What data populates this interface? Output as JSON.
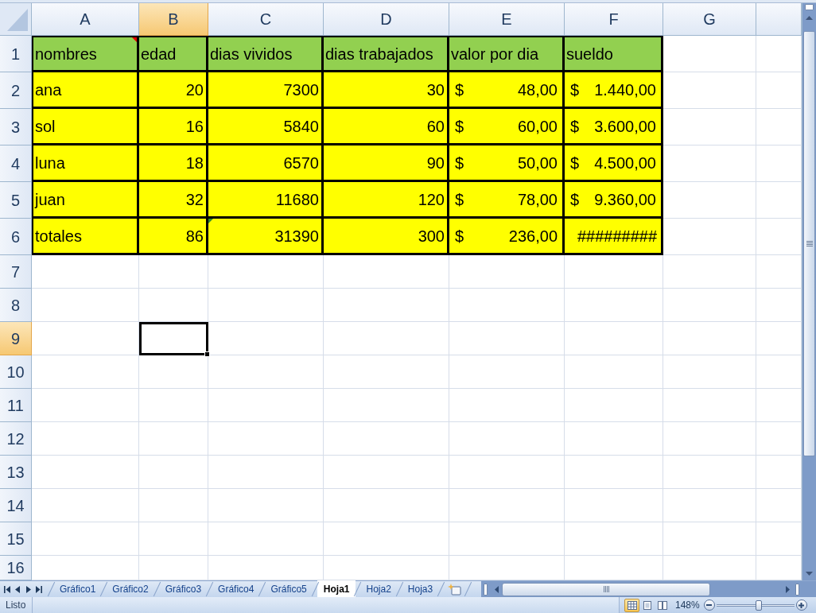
{
  "columns": [
    {
      "label": "A",
      "selected": false
    },
    {
      "label": "B",
      "selected": true
    },
    {
      "label": "C",
      "selected": false
    },
    {
      "label": "D",
      "selected": false
    },
    {
      "label": "E",
      "selected": false
    },
    {
      "label": "F",
      "selected": false
    },
    {
      "label": "G",
      "selected": false
    }
  ],
  "rows": [
    {
      "label": "1",
      "selected": false,
      "color": "#92d050",
      "cells": [
        {
          "kind": "text",
          "value": "nombres",
          "comment": true,
          "error_flag": false
        },
        {
          "kind": "text",
          "value": "edad",
          "comment": false,
          "error_flag": false
        },
        {
          "kind": "text",
          "value": "dias vividos",
          "comment": false,
          "error_flag": false
        },
        {
          "kind": "text",
          "value": "dias trabajados",
          "comment": false,
          "error_flag": false
        },
        {
          "kind": "text",
          "value": "valor por dia",
          "comment": false,
          "error_flag": false
        },
        {
          "kind": "text",
          "value": "sueldo",
          "comment": false,
          "error_flag": false
        }
      ]
    },
    {
      "label": "2",
      "selected": false,
      "color": "#ffff00",
      "cells": [
        {
          "kind": "text",
          "value": "ana",
          "comment": false,
          "error_flag": false
        },
        {
          "kind": "number",
          "value": "20",
          "comment": false,
          "error_flag": false
        },
        {
          "kind": "number",
          "value": "7300",
          "comment": false,
          "error_flag": false
        },
        {
          "kind": "number",
          "value": "30",
          "comment": false,
          "error_flag": false
        },
        {
          "kind": "currency",
          "symbol": "$",
          "value": "48,00",
          "comment": false,
          "error_flag": false
        },
        {
          "kind": "currency",
          "symbol": "$",
          "value": "1.440,00",
          "comment": false,
          "error_flag": false
        }
      ]
    },
    {
      "label": "3",
      "selected": false,
      "color": "#ffff00",
      "cells": [
        {
          "kind": "text",
          "value": "sol",
          "comment": false,
          "error_flag": false
        },
        {
          "kind": "number",
          "value": "16",
          "comment": false,
          "error_flag": false
        },
        {
          "kind": "number",
          "value": "5840",
          "comment": false,
          "error_flag": false
        },
        {
          "kind": "number",
          "value": "60",
          "comment": false,
          "error_flag": false
        },
        {
          "kind": "currency",
          "symbol": "$",
          "value": "60,00",
          "comment": false,
          "error_flag": false
        },
        {
          "kind": "currency",
          "symbol": "$",
          "value": "3.600,00",
          "comment": false,
          "error_flag": false
        }
      ]
    },
    {
      "label": "4",
      "selected": false,
      "color": "#ffff00",
      "cells": [
        {
          "kind": "text",
          "value": "luna",
          "comment": false,
          "error_flag": false
        },
        {
          "kind": "number",
          "value": "18",
          "comment": false,
          "error_flag": false
        },
        {
          "kind": "number",
          "value": "6570",
          "comment": false,
          "error_flag": false
        },
        {
          "kind": "number",
          "value": "90",
          "comment": false,
          "error_flag": false
        },
        {
          "kind": "currency",
          "symbol": "$",
          "value": "50,00",
          "comment": false,
          "error_flag": false
        },
        {
          "kind": "currency",
          "symbol": "$",
          "value": "4.500,00",
          "comment": false,
          "error_flag": false
        }
      ]
    },
    {
      "label": "5",
      "selected": false,
      "color": "#ffff00",
      "cells": [
        {
          "kind": "text",
          "value": "juan",
          "comment": false,
          "error_flag": false
        },
        {
          "kind": "number",
          "value": "32",
          "comment": false,
          "error_flag": false
        },
        {
          "kind": "number",
          "value": "11680",
          "comment": false,
          "error_flag": false
        },
        {
          "kind": "number",
          "value": "120",
          "comment": false,
          "error_flag": false
        },
        {
          "kind": "currency",
          "symbol": "$",
          "value": "78,00",
          "comment": false,
          "error_flag": false
        },
        {
          "kind": "currency",
          "symbol": "$",
          "value": "9.360,00",
          "comment": false,
          "error_flag": false
        }
      ]
    },
    {
      "label": "6",
      "selected": false,
      "color": "#ffff00",
      "cells": [
        {
          "kind": "text",
          "value": "totales",
          "comment": false,
          "error_flag": false
        },
        {
          "kind": "number",
          "value": "86",
          "comment": false,
          "error_flag": false
        },
        {
          "kind": "number",
          "value": "31390",
          "comment": false,
          "error_flag": true
        },
        {
          "kind": "number",
          "value": "300",
          "comment": false,
          "error_flag": false
        },
        {
          "kind": "currency",
          "symbol": "$",
          "value": "236,00",
          "comment": false,
          "error_flag": false
        },
        {
          "kind": "overflow",
          "value": "#########",
          "comment": false,
          "error_flag": false
        }
      ]
    },
    {
      "label": "7",
      "selected": false
    },
    {
      "label": "8",
      "selected": false
    },
    {
      "label": "9",
      "selected": true
    },
    {
      "label": "10",
      "selected": false
    },
    {
      "label": "11",
      "selected": false
    },
    {
      "label": "12",
      "selected": false
    },
    {
      "label": "13",
      "selected": false
    },
    {
      "label": "14",
      "selected": false
    },
    {
      "label": "15",
      "selected": false
    },
    {
      "label": "16",
      "selected": false
    }
  ],
  "sheet_tabs": [
    {
      "label": "Gráfico1",
      "selected": false
    },
    {
      "label": "Gráfico2",
      "selected": false
    },
    {
      "label": "Gráfico3",
      "selected": false
    },
    {
      "label": "Gráfico4",
      "selected": false
    },
    {
      "label": "Gráfico5",
      "selected": false
    },
    {
      "label": "Hoja1",
      "selected": true
    },
    {
      "label": "Hoja2",
      "selected": false
    },
    {
      "label": "Hoja3",
      "selected": false
    }
  ],
  "status_bar": {
    "status": "Listo",
    "views": [
      {
        "kind": "normal",
        "selected": true
      },
      {
        "kind": "page_layout",
        "selected": false
      },
      {
        "kind": "page_break_preview",
        "selected": false
      }
    ],
    "zoom": "148%",
    "zoom_slider": {
      "level": 0.54
    }
  }
}
